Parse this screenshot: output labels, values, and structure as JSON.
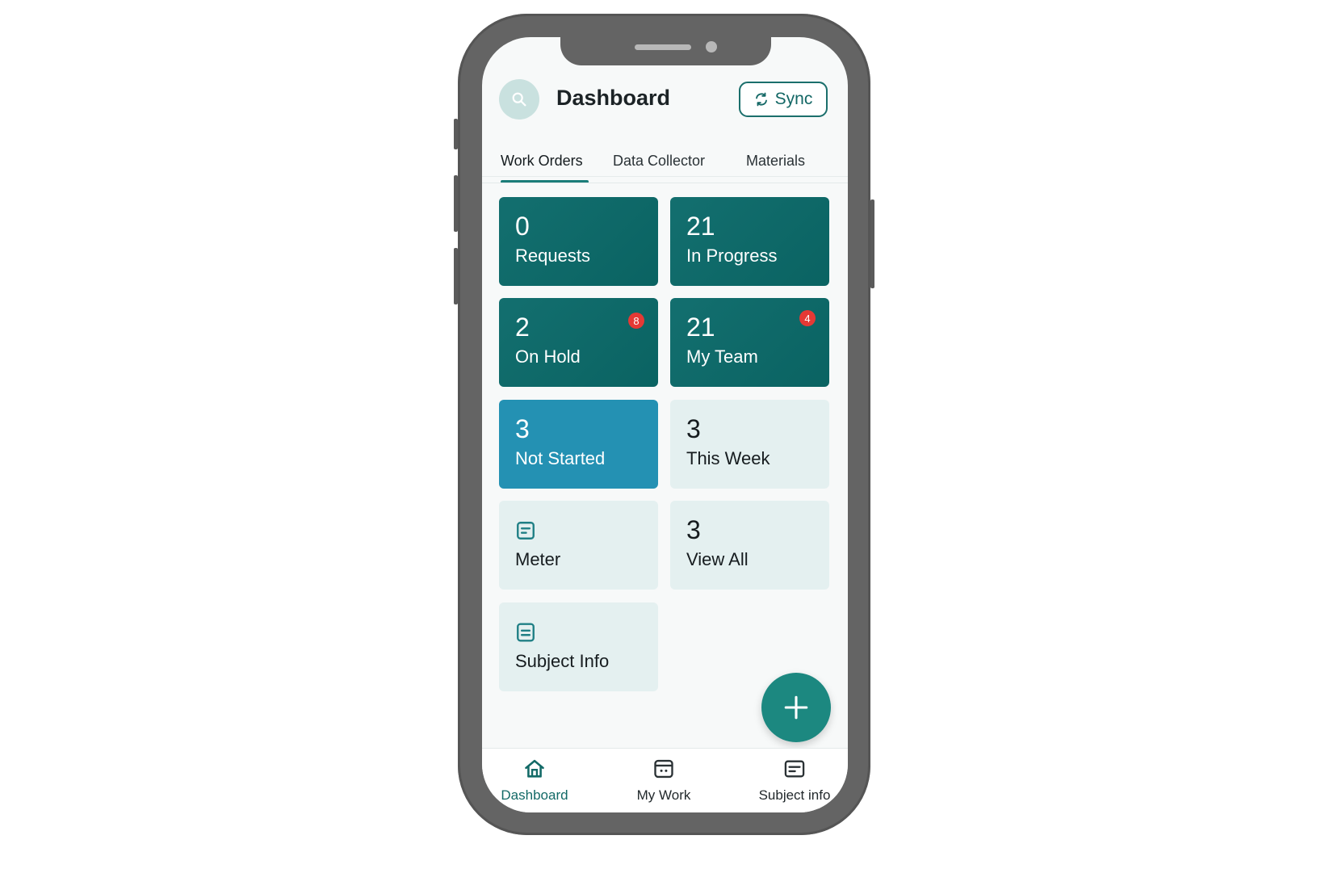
{
  "header": {
    "title": "Dashboard",
    "search_icon": "search-icon",
    "sync_label": "Sync",
    "sync_icon": "refresh-icon"
  },
  "tabs": [
    {
      "label": "Work Orders",
      "active": true
    },
    {
      "label": "Data Collector",
      "active": false
    },
    {
      "label": "Materials",
      "active": false
    }
  ],
  "tiles": [
    {
      "count": "0",
      "label": "Requests",
      "style": "dark"
    },
    {
      "count": "21",
      "label": "In Progress",
      "style": "dark"
    },
    {
      "count": "2",
      "label": "On Hold",
      "style": "dark",
      "badge": "8"
    },
    {
      "count": "21",
      "label": "My Team",
      "style": "dark",
      "badge": "4"
    },
    {
      "count": "3",
      "label": "Not Started",
      "style": "blue"
    },
    {
      "count": "3",
      "label": "This Week",
      "style": "light"
    },
    {
      "icon": "form-icon",
      "label": "Meter",
      "style": "light"
    },
    {
      "count": "3",
      "label": "View All",
      "style": "light"
    },
    {
      "icon": "document-icon",
      "label": "Subject Info",
      "style": "light"
    }
  ],
  "fab": {
    "icon": "plus-icon"
  },
  "bottom_nav": [
    {
      "label": "Dashboard",
      "icon": "home-icon",
      "active": true
    },
    {
      "label": "My Work",
      "icon": "calendar-icon",
      "active": false
    },
    {
      "label": "Subject info",
      "icon": "subject-card-icon",
      "active": false
    }
  ],
  "colors": {
    "accent": "#1b7d79",
    "tile_dark": "#0e6968",
    "tile_blue": "#2491b3",
    "tile_light": "#e4f0f0",
    "badge": "#e53935",
    "phone_frame": "#646464"
  }
}
